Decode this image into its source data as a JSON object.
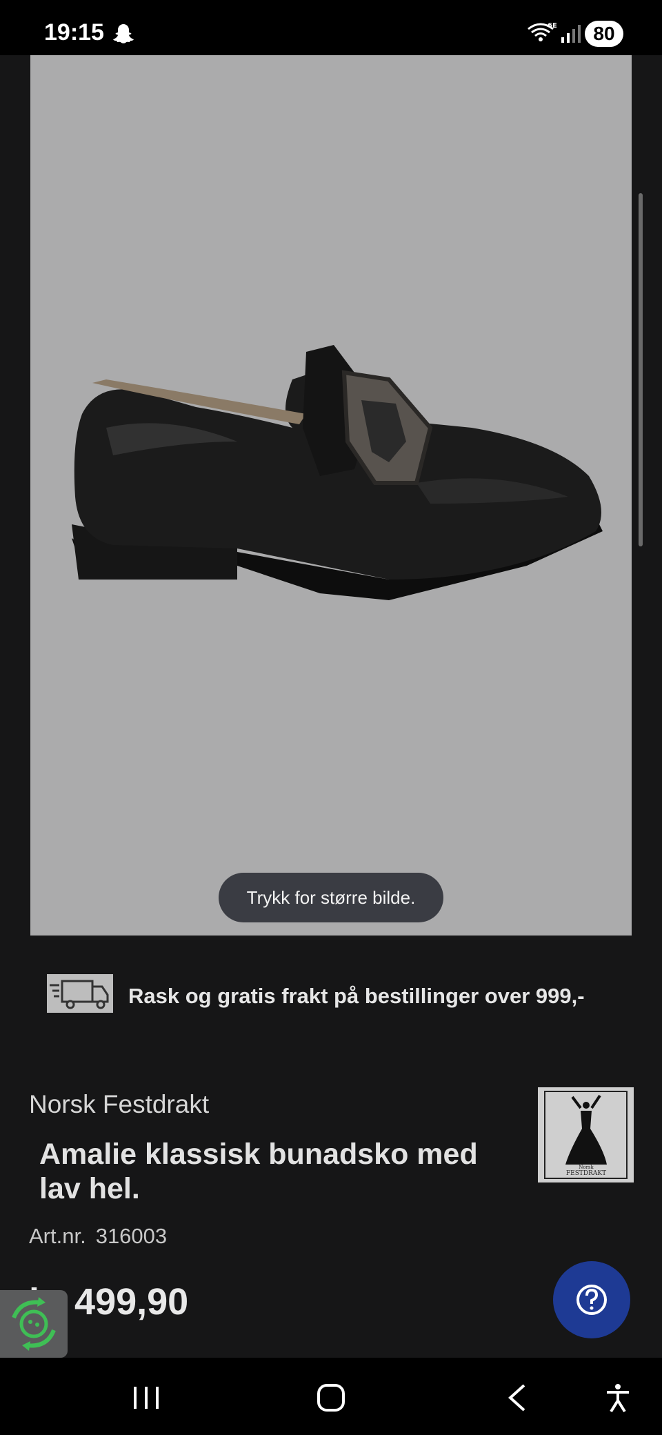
{
  "status_bar": {
    "time": "19:15",
    "battery": "80",
    "icons": [
      "snapchat-icon",
      "wifi-6e-icon",
      "signal-icon",
      "battery-icon"
    ]
  },
  "product_image": {
    "hint": "Trykk for større bilde."
  },
  "shipping": {
    "icon": "truck-icon",
    "text": "Rask og gratis frakt på bestillinger over 999,-"
  },
  "product": {
    "brand": "Norsk Festdrakt",
    "title": "Amalie klassisk bunadsko med lav hel.",
    "art_label": "Art.nr.",
    "art_number": "316003",
    "price": "kr 499,90"
  },
  "brand_logo": {
    "top_text": "Norsk",
    "bottom_text": "FESTDRAKT"
  },
  "colors": {
    "background": "#161617",
    "image_background": "#ababac",
    "help_button": "#1e3a94",
    "recycle_green": "#3fbf55"
  },
  "nav_bar": {
    "buttons": [
      "recent-apps-icon",
      "home-icon",
      "back-icon",
      "accessibility-icon"
    ]
  }
}
